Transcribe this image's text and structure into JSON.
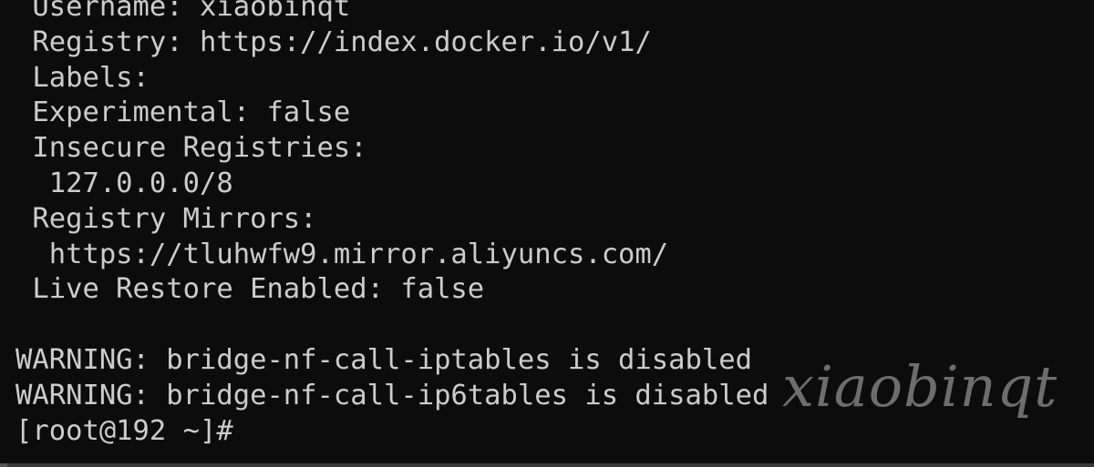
{
  "terminal": {
    "lines": [
      " Username: xiaobinqt",
      " Registry: https://index.docker.io/v1/",
      " Labels:",
      " Experimental: false",
      " Insecure Registries:",
      "  127.0.0.0/8",
      " Registry Mirrors:",
      "  https://tluhwfw9.mirror.aliyuncs.com/",
      " Live Restore Enabled: false",
      "",
      "WARNING: bridge-nf-call-iptables is disabled",
      "WARNING: bridge-nf-call-ip6tables is disabled"
    ],
    "prompt": "[root@192 ~]#"
  },
  "watermark": {
    "text": "xiaobinqt"
  },
  "colors": {
    "background": "#0c0c0c",
    "text": "#cccccc"
  }
}
